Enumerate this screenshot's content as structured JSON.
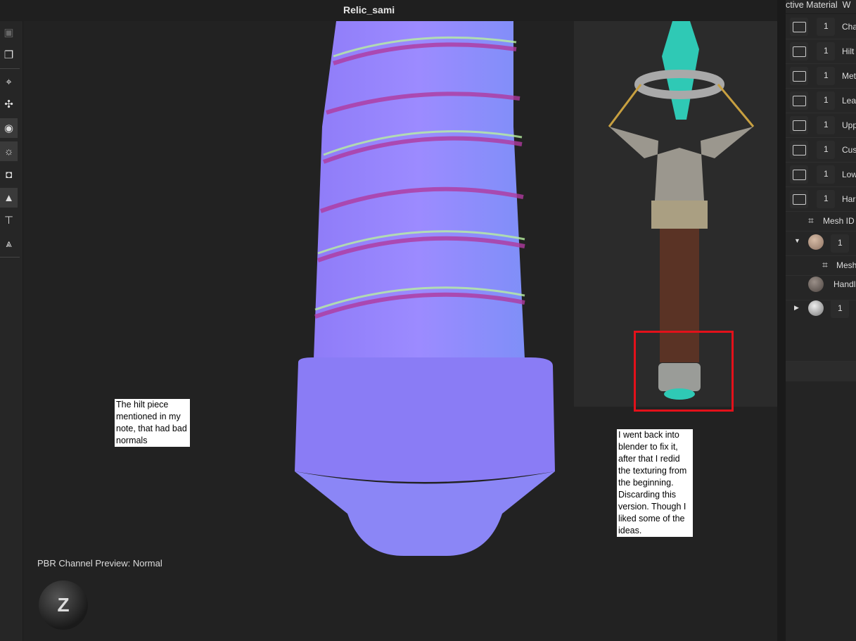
{
  "window": {
    "title": "Relic_sami"
  },
  "toolbar": {
    "tools": [
      "save-icon",
      "clipboard-icon",
      "crosshair-icon",
      "nodes-icon",
      "eye-hidden-icon",
      "light-icon",
      "camera-icon",
      "environment-icon",
      "presentation-icon",
      "bake-icon"
    ]
  },
  "panel": {
    "header_1": "ctive Material",
    "header_2": "W",
    "folders": [
      {
        "count": "1",
        "label": "Cha"
      },
      {
        "count": "1",
        "label": "Hilt"
      },
      {
        "count": "1",
        "label": "Met"
      },
      {
        "count": "1",
        "label": "Lea"
      },
      {
        "count": "1",
        "label": "Upp"
      },
      {
        "count": "1",
        "label": "Cus"
      },
      {
        "count": "1",
        "label": "Low"
      },
      {
        "count": "1",
        "label": "Har"
      }
    ],
    "mesh_id_1": "Mesh ID",
    "layer_count_1": "1",
    "mesh_id_2": "Mesh",
    "handle_label": "Handl",
    "layer_count_2": "1"
  },
  "viewport": {
    "channel_preview": "PBR Channel Preview: Normal",
    "nav_cube_label": "Z"
  },
  "notes": {
    "left": "The hilt piece mentioned in my note, that had bad normals",
    "right": "I went back into blender to fix it, after that I redid the texturing from the beginning. Discarding this version. Though I liked some of the ideas."
  },
  "colors": {
    "highlight": "#e3111a",
    "normal_map": "#8080ff"
  }
}
